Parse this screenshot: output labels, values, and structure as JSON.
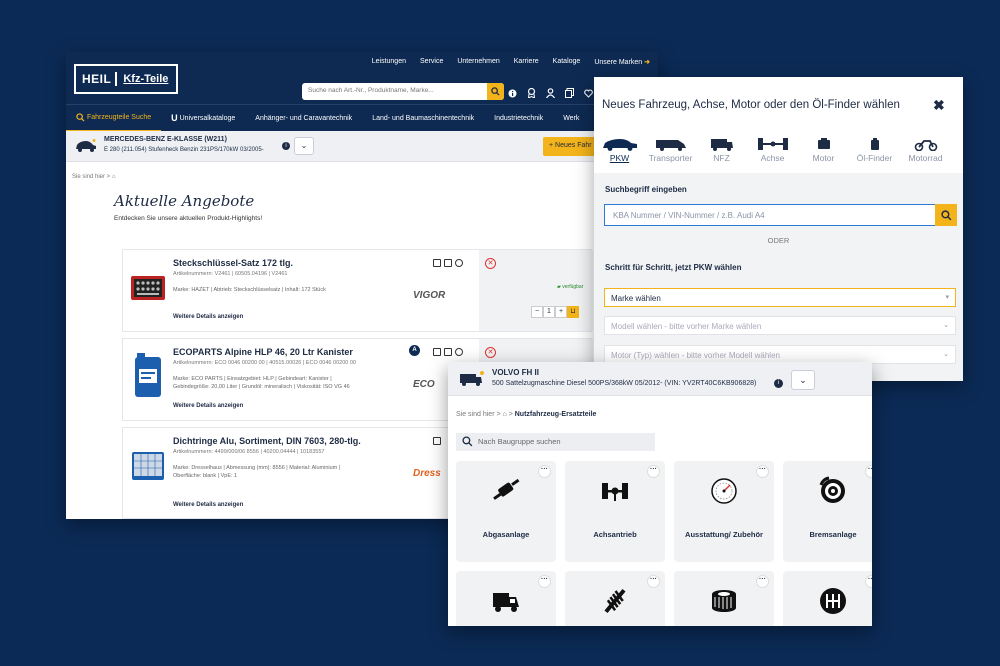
{
  "colors": {
    "navy": "#0e2a52",
    "accent": "#f3b31a",
    "background": "#0b2a55"
  },
  "main": {
    "topnav": [
      "Leistungen",
      "Service",
      "Unternehmen",
      "Karriere",
      "Kataloge",
      "Unsere Marken"
    ],
    "logo": {
      "part1": "HEIL",
      "part2": "Kfz-Teile"
    },
    "search_placeholder": "Suche nach Art.-Nr., Produktname, Marke...",
    "nav": [
      "Fahrzeugteile Suche",
      "Universalkataloge",
      "Anhänger- und Caravantechnik",
      "Land- und Baumaschinentechnik",
      "Industrietechnik",
      "Werk"
    ],
    "vehicle": {
      "title": "MERCEDES-BENZ E-KLASSE (W211)",
      "subtitle": "E 280 (211.054) Stufenheck Benzin 231PS/170kW 03/2005-"
    },
    "new_vehicle_button": "+ Neues Fahr",
    "breadcrumb": "Sie sind hier >",
    "title": "Aktuelle Angebote",
    "subtitle": "Entdecken Sie unsere aktuellen Produkt-Highlights!",
    "more_details": "Weitere Details anzeigen",
    "availability": "verfügbar",
    "products": [
      {
        "name": "Steckschlüssel-Satz 172 tlg.",
        "partno": "Artikelnummern: V2461 | 60505.04196 | V2461",
        "desc": "Marke: HAZET | Abtrieb: Steckschlüsselsatz | Inhalt: 172 Stück",
        "brand": "VIGOR"
      },
      {
        "name": "ECOPARTS Alpine HLP 46, 20 Ltr Kanister",
        "partno": "Artikelnummern: ECO 0046 00200 00 | 40515.00026 | ECO 0046 00200 00",
        "desc": "Marke: ECO PARTS | Einsatzgebiet: HLP | Gebindeart: Kanister | Gebindegröße: 20,00 Liter | Grundöl: mineralisch | Viskosität: ISO VG 46",
        "brand": "ECO",
        "badge": "A"
      },
      {
        "name": "Dichtringe Alu, Sortiment, DIN 7603, 280-tlg.",
        "partno": "Artikelnummern: 4499/000/06 8556 | 40200.04444 | 10183557",
        "desc": "Marke: Dresselhaus | Abmessung (mm): 8556 | Material: Aluminium | Oberfläche: blank | VpE: 1",
        "brand": "Dress"
      }
    ]
  },
  "finder": {
    "title": "Neues Fahrzeug, Achse, Motor oder den Öl-Finder wählen",
    "close": "✖",
    "tabs": [
      "PKW",
      "Transporter",
      "NFZ",
      "Achse",
      "Motor",
      "Öl-Finder",
      "Motorrad"
    ],
    "search_label": "Suchbegriff eingeben",
    "search_placeholder": "KBA Nummer / VIN-Nummer / z.B. Audi A4",
    "or": "ODER",
    "step_label": "Schritt für Schritt, jetzt PKW wählen",
    "selects": [
      "Marke wählen",
      "Modell wählen - bitte vorher Marke wählen",
      "Motor (Typ) wählen - bitte vorher Modell wählen"
    ]
  },
  "truck": {
    "vehicle": {
      "title": "VOLVO FH II",
      "subtitle": "500 Sattelzugmaschine Diesel 500PS/368kW 05/2012- (VIN: YV2RT40C6KB906828)"
    },
    "breadcrumb_prefix": "Sie sind hier >",
    "breadcrumb_current": "Nutzfahrzeug-Ersatzteile",
    "search_placeholder": "Nach Baugruppe suchen",
    "categories": [
      "Abgasanlage",
      "Achsantrieb",
      "Ausstattung/ Zubehör",
      "Bremsanlage",
      "",
      "",
      "",
      ""
    ]
  }
}
